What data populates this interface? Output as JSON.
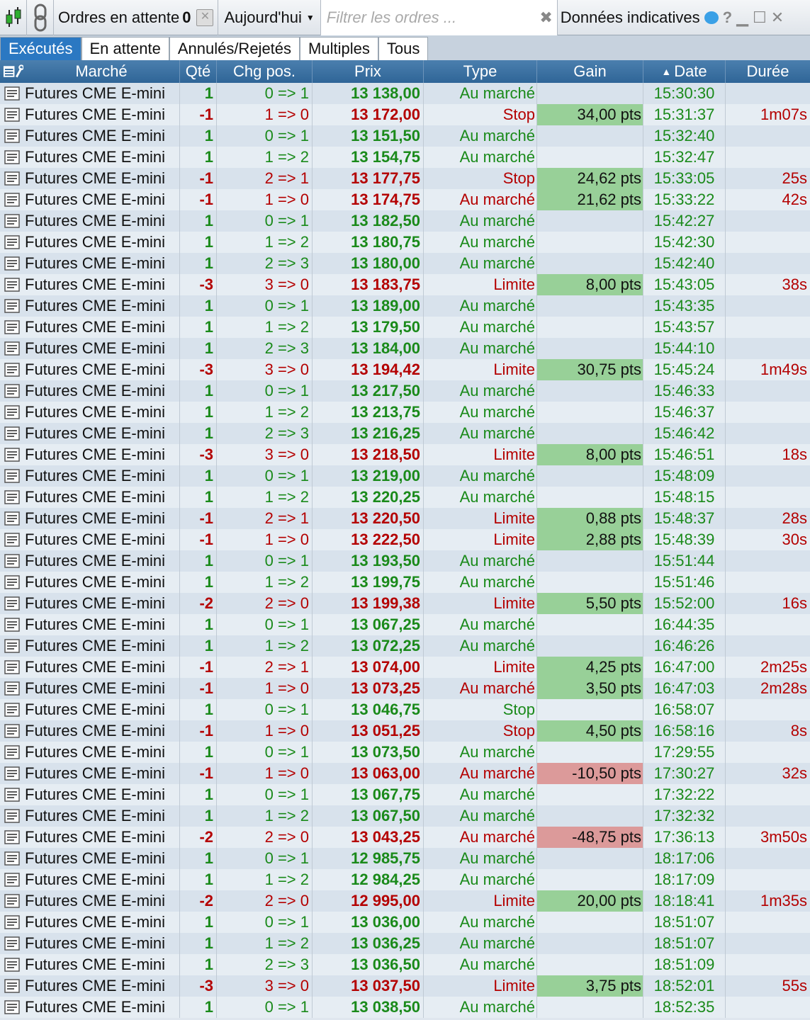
{
  "toolbar": {
    "pending_label": "Ordres en attente",
    "pending_count": "0",
    "date_filter": "Aujourd'hui",
    "filter_placeholder": "Filtrer les ordres ...",
    "data_label": "Données indicatives",
    "help": "?"
  },
  "tabs": [
    "Exécutés",
    "En attente",
    "Annulés/Rejetés",
    "Multiples",
    "Tous"
  ],
  "active_tab": 0,
  "columns": {
    "market": "Marché",
    "qty": "Qté",
    "chg": "Chg pos.",
    "price": "Prix",
    "type": "Type",
    "gain": "Gain",
    "date": "Date",
    "duration": "Durée"
  },
  "colors": {
    "buy": "#1a8a1a",
    "sell": "#b40000",
    "gain_positive": "#98d098",
    "gain_negative": "#dc9a9a",
    "tab_active": "#2b78c2"
  },
  "rows": [
    [
      "Futures CME E-mini",
      "1",
      "0 => 1",
      "13 138,00",
      "Au marché",
      "",
      "15:30:30",
      ""
    ],
    [
      "Futures CME E-mini",
      "-1",
      "1 => 0",
      "13 172,00",
      "Stop",
      "34,00 pts",
      "15:31:37",
      "1m07s"
    ],
    [
      "Futures CME E-mini",
      "1",
      "0 => 1",
      "13 151,50",
      "Au marché",
      "",
      "15:32:40",
      ""
    ],
    [
      "Futures CME E-mini",
      "1",
      "1 => 2",
      "13 154,75",
      "Au marché",
      "",
      "15:32:47",
      ""
    ],
    [
      "Futures CME E-mini",
      "-1",
      "2 => 1",
      "13 177,75",
      "Stop",
      "24,62 pts",
      "15:33:05",
      "25s"
    ],
    [
      "Futures CME E-mini",
      "-1",
      "1 => 0",
      "13 174,75",
      "Au marché",
      "21,62 pts",
      "15:33:22",
      "42s"
    ],
    [
      "Futures CME E-mini",
      "1",
      "0 => 1",
      "13 182,50",
      "Au marché",
      "",
      "15:42:27",
      ""
    ],
    [
      "Futures CME E-mini",
      "1",
      "1 => 2",
      "13 180,75",
      "Au marché",
      "",
      "15:42:30",
      ""
    ],
    [
      "Futures CME E-mini",
      "1",
      "2 => 3",
      "13 180,00",
      "Au marché",
      "",
      "15:42:40",
      ""
    ],
    [
      "Futures CME E-mini",
      "-3",
      "3 => 0",
      "13 183,75",
      "Limite",
      "8,00 pts",
      "15:43:05",
      "38s"
    ],
    [
      "Futures CME E-mini",
      "1",
      "0 => 1",
      "13 189,00",
      "Au marché",
      "",
      "15:43:35",
      ""
    ],
    [
      "Futures CME E-mini",
      "1",
      "1 => 2",
      "13 179,50",
      "Au marché",
      "",
      "15:43:57",
      ""
    ],
    [
      "Futures CME E-mini",
      "1",
      "2 => 3",
      "13 184,00",
      "Au marché",
      "",
      "15:44:10",
      ""
    ],
    [
      "Futures CME E-mini",
      "-3",
      "3 => 0",
      "13 194,42",
      "Limite",
      "30,75 pts",
      "15:45:24",
      "1m49s"
    ],
    [
      "Futures CME E-mini",
      "1",
      "0 => 1",
      "13 217,50",
      "Au marché",
      "",
      "15:46:33",
      ""
    ],
    [
      "Futures CME E-mini",
      "1",
      "1 => 2",
      "13 213,75",
      "Au marché",
      "",
      "15:46:37",
      ""
    ],
    [
      "Futures CME E-mini",
      "1",
      "2 => 3",
      "13 216,25",
      "Au marché",
      "",
      "15:46:42",
      ""
    ],
    [
      "Futures CME E-mini",
      "-3",
      "3 => 0",
      "13 218,50",
      "Limite",
      "8,00 pts",
      "15:46:51",
      "18s"
    ],
    [
      "Futures CME E-mini",
      "1",
      "0 => 1",
      "13 219,00",
      "Au marché",
      "",
      "15:48:09",
      ""
    ],
    [
      "Futures CME E-mini",
      "1",
      "1 => 2",
      "13 220,25",
      "Au marché",
      "",
      "15:48:15",
      ""
    ],
    [
      "Futures CME E-mini",
      "-1",
      "2 => 1",
      "13 220,50",
      "Limite",
      "0,88 pts",
      "15:48:37",
      "28s"
    ],
    [
      "Futures CME E-mini",
      "-1",
      "1 => 0",
      "13 222,50",
      "Limite",
      "2,88 pts",
      "15:48:39",
      "30s"
    ],
    [
      "Futures CME E-mini",
      "1",
      "0 => 1",
      "13 193,50",
      "Au marché",
      "",
      "15:51:44",
      ""
    ],
    [
      "Futures CME E-mini",
      "1",
      "1 => 2",
      "13 199,75",
      "Au marché",
      "",
      "15:51:46",
      ""
    ],
    [
      "Futures CME E-mini",
      "-2",
      "2 => 0",
      "13 199,38",
      "Limite",
      "5,50 pts",
      "15:52:00",
      "16s"
    ],
    [
      "Futures CME E-mini",
      "1",
      "0 => 1",
      "13 067,25",
      "Au marché",
      "",
      "16:44:35",
      ""
    ],
    [
      "Futures CME E-mini",
      "1",
      "1 => 2",
      "13 072,25",
      "Au marché",
      "",
      "16:46:26",
      ""
    ],
    [
      "Futures CME E-mini",
      "-1",
      "2 => 1",
      "13 074,00",
      "Limite",
      "4,25 pts",
      "16:47:00",
      "2m25s"
    ],
    [
      "Futures CME E-mini",
      "-1",
      "1 => 0",
      "13 073,25",
      "Au marché",
      "3,50 pts",
      "16:47:03",
      "2m28s"
    ],
    [
      "Futures CME E-mini",
      "1",
      "0 => 1",
      "13 046,75",
      "Stop",
      "",
      "16:58:07",
      ""
    ],
    [
      "Futures CME E-mini",
      "-1",
      "1 => 0",
      "13 051,25",
      "Stop",
      "4,50 pts",
      "16:58:16",
      "8s"
    ],
    [
      "Futures CME E-mini",
      "1",
      "0 => 1",
      "13 073,50",
      "Au marché",
      "",
      "17:29:55",
      ""
    ],
    [
      "Futures CME E-mini",
      "-1",
      "1 => 0",
      "13 063,00",
      "Au marché",
      "-10,50 pts",
      "17:30:27",
      "32s"
    ],
    [
      "Futures CME E-mini",
      "1",
      "0 => 1",
      "13 067,75",
      "Au marché",
      "",
      "17:32:22",
      ""
    ],
    [
      "Futures CME E-mini",
      "1",
      "1 => 2",
      "13 067,50",
      "Au marché",
      "",
      "17:32:32",
      ""
    ],
    [
      "Futures CME E-mini",
      "-2",
      "2 => 0",
      "13 043,25",
      "Au marché",
      "-48,75 pts",
      "17:36:13",
      "3m50s"
    ],
    [
      "Futures CME E-mini",
      "1",
      "0 => 1",
      "12 985,75",
      "Au marché",
      "",
      "18:17:06",
      ""
    ],
    [
      "Futures CME E-mini",
      "1",
      "1 => 2",
      "12 984,25",
      "Au marché",
      "",
      "18:17:09",
      ""
    ],
    [
      "Futures CME E-mini",
      "-2",
      "2 => 0",
      "12 995,00",
      "Limite",
      "20,00 pts",
      "18:18:41",
      "1m35s"
    ],
    [
      "Futures CME E-mini",
      "1",
      "0 => 1",
      "13 036,00",
      "Au marché",
      "",
      "18:51:07",
      ""
    ],
    [
      "Futures CME E-mini",
      "1",
      "1 => 2",
      "13 036,25",
      "Au marché",
      "",
      "18:51:07",
      ""
    ],
    [
      "Futures CME E-mini",
      "1",
      "2 => 3",
      "13 036,50",
      "Au marché",
      "",
      "18:51:09",
      ""
    ],
    [
      "Futures CME E-mini",
      "-3",
      "3 => 0",
      "13 037,50",
      "Limite",
      "3,75 pts",
      "18:52:01",
      "55s"
    ],
    [
      "Futures CME E-mini",
      "1",
      "0 => 1",
      "13 038,50",
      "Au marché",
      "",
      "18:52:35",
      ""
    ]
  ]
}
